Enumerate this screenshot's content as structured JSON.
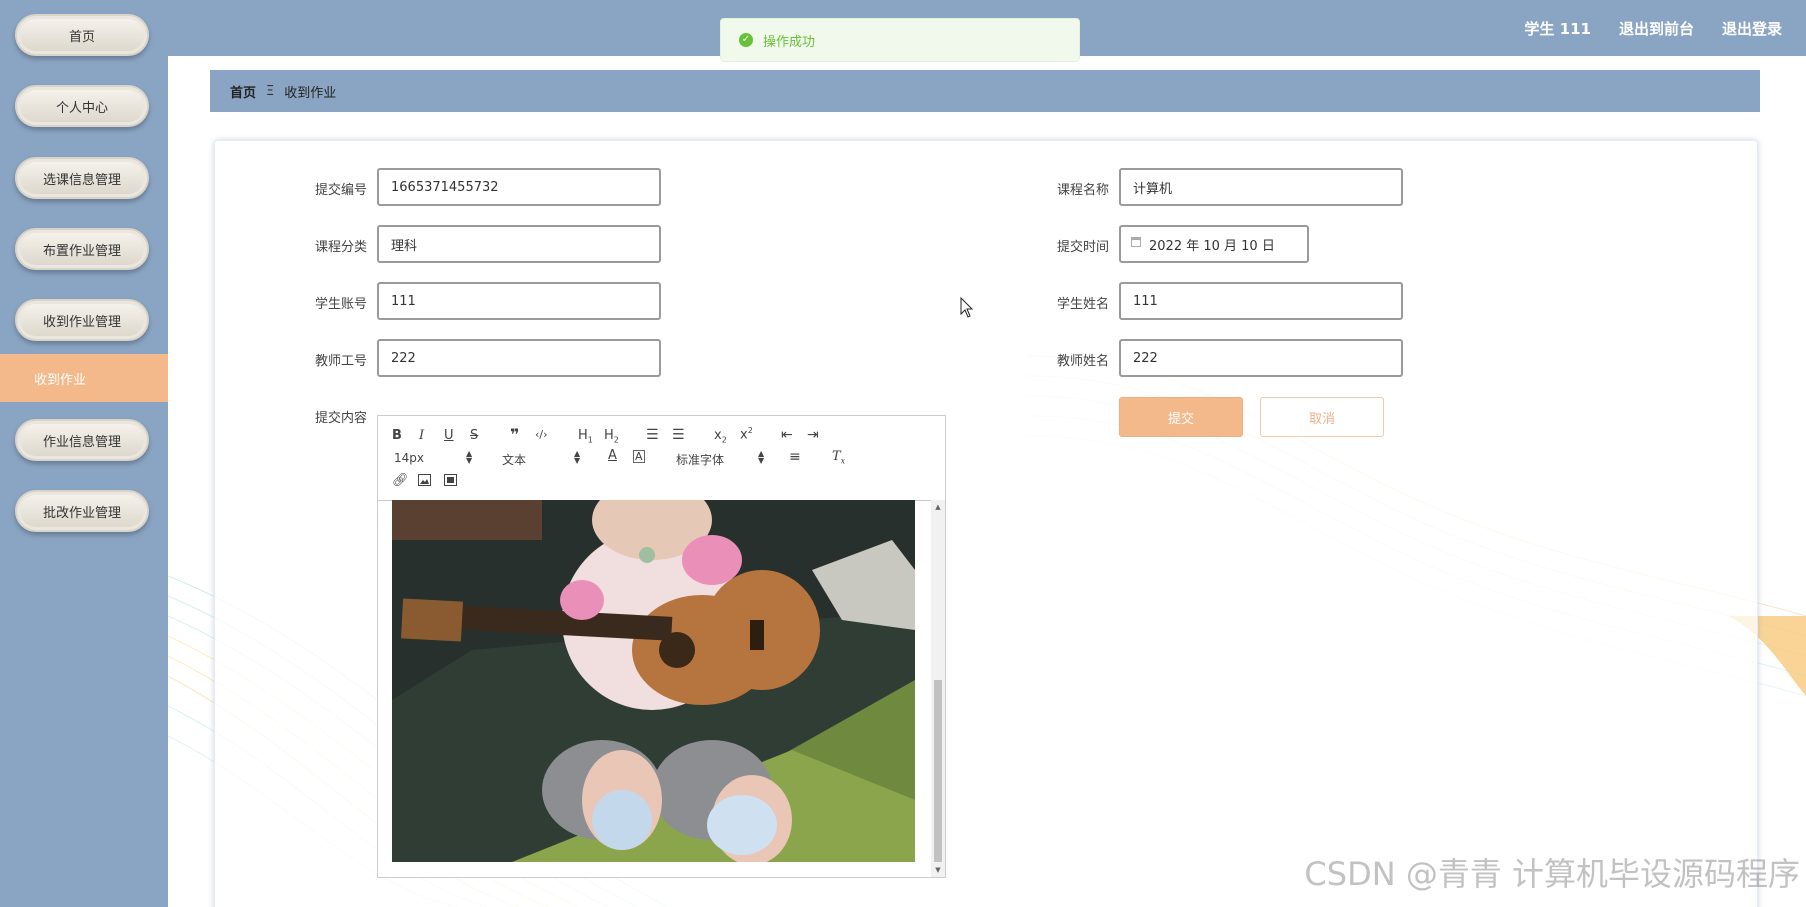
{
  "sidebar": {
    "items": [
      {
        "label": "首页"
      },
      {
        "label": "个人中心"
      },
      {
        "label": "选课信息管理"
      },
      {
        "label": "布置作业管理"
      },
      {
        "label": "收到作业管理"
      },
      {
        "label": "作业信息管理"
      },
      {
        "label": "批改作业管理"
      }
    ],
    "active_sub": "收到作业"
  },
  "header": {
    "user": "学生 111",
    "to_front": "退出到前台",
    "logout": "退出登录"
  },
  "toast": {
    "message": "操作成功",
    "color": "#67c23a"
  },
  "breadcrumb": {
    "home": "首页",
    "separator": "Ξ",
    "current": "收到作业"
  },
  "form": {
    "submit_no": {
      "label": "提交编号",
      "value": "1665371455732"
    },
    "course_name": {
      "label": "课程名称",
      "value": "计算机"
    },
    "course_category": {
      "label": "课程分类",
      "value": "理科"
    },
    "submit_time": {
      "label": "提交时间",
      "value": "2022 年 10 月 10 日"
    },
    "student_account": {
      "label": "学生账号",
      "value": "111"
    },
    "student_name": {
      "label": "学生姓名",
      "value": "111"
    },
    "teacher_id": {
      "label": "教师工号",
      "value": "222"
    },
    "teacher_name": {
      "label": "教师姓名",
      "value": "222"
    },
    "content_label": "提交内容",
    "submit_button": "提交",
    "cancel_button": "取消"
  },
  "editor": {
    "font_size": "14px",
    "paragraph": "文本",
    "font_family": "标准字体"
  },
  "watermark": "CSDN @青青  计算机毕设源码程序",
  "colors": {
    "sidebar_bg": "#8aa5c3",
    "accent": "#f3b98a"
  }
}
